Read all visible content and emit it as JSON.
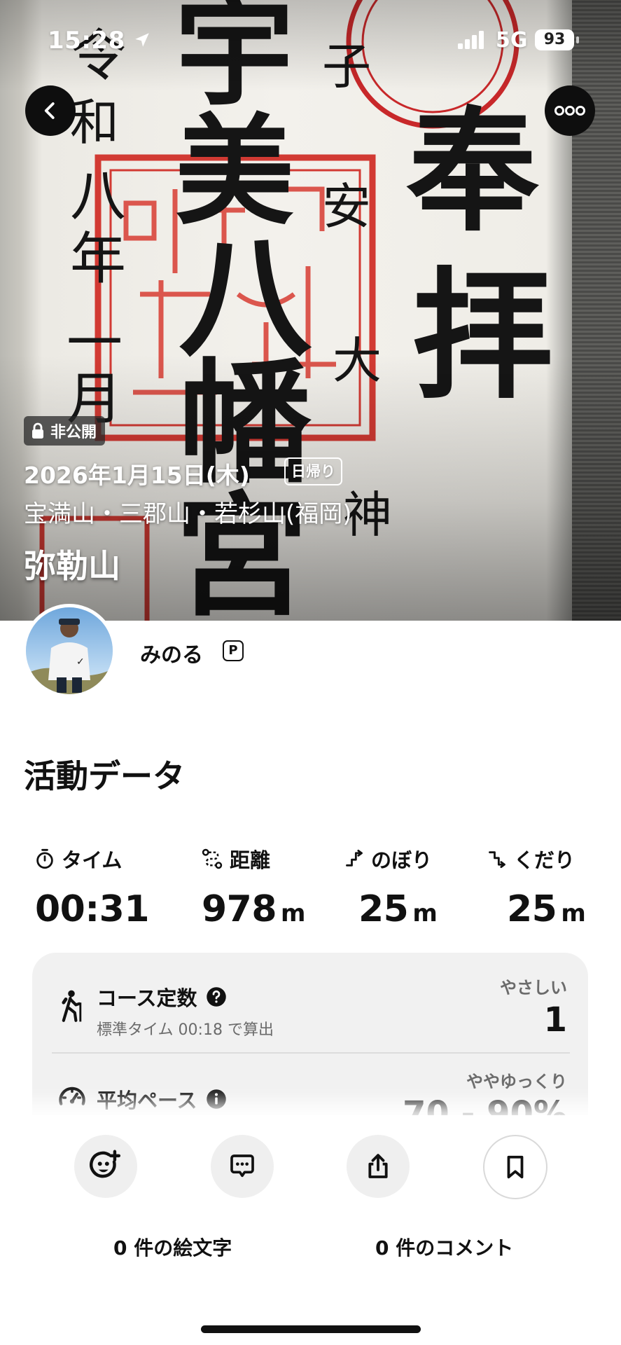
{
  "status_bar": {
    "time": "15:28",
    "network": "5G",
    "battery": "93"
  },
  "hero": {
    "visibility_label": "非公開",
    "date": "2026年1月15日(木)",
    "trip_type": "日帰り",
    "area": "宝満山・三郡山・若杉山(福岡)",
    "mountain": "弥勒山"
  },
  "user": {
    "name": "みのる",
    "badge": "P"
  },
  "activity": {
    "title": "活動データ",
    "stats": [
      {
        "label": "タイム",
        "value": "00:31",
        "unit": "",
        "icon": "timer-icon"
      },
      {
        "label": "距離",
        "value": "978",
        "unit": "m",
        "icon": "route-icon"
      },
      {
        "label": "のぼり",
        "value": "25",
        "unit": "m",
        "icon": "ascent-icon"
      },
      {
        "label": "くだり",
        "value": "25",
        "unit": "m",
        "icon": "descent-icon"
      }
    ],
    "course_constant": {
      "title": "コース定数",
      "subtitle": "標準タイム 00:18 で算出",
      "rating": "やさしい",
      "value": "1"
    },
    "average_pace": {
      "title": "平均ペース",
      "rating": "ややゆっくり",
      "value": "70 - 90%"
    }
  },
  "actions": {
    "emoji_count": "0 件の絵文字",
    "comment_count": "0 件のコメント"
  }
}
